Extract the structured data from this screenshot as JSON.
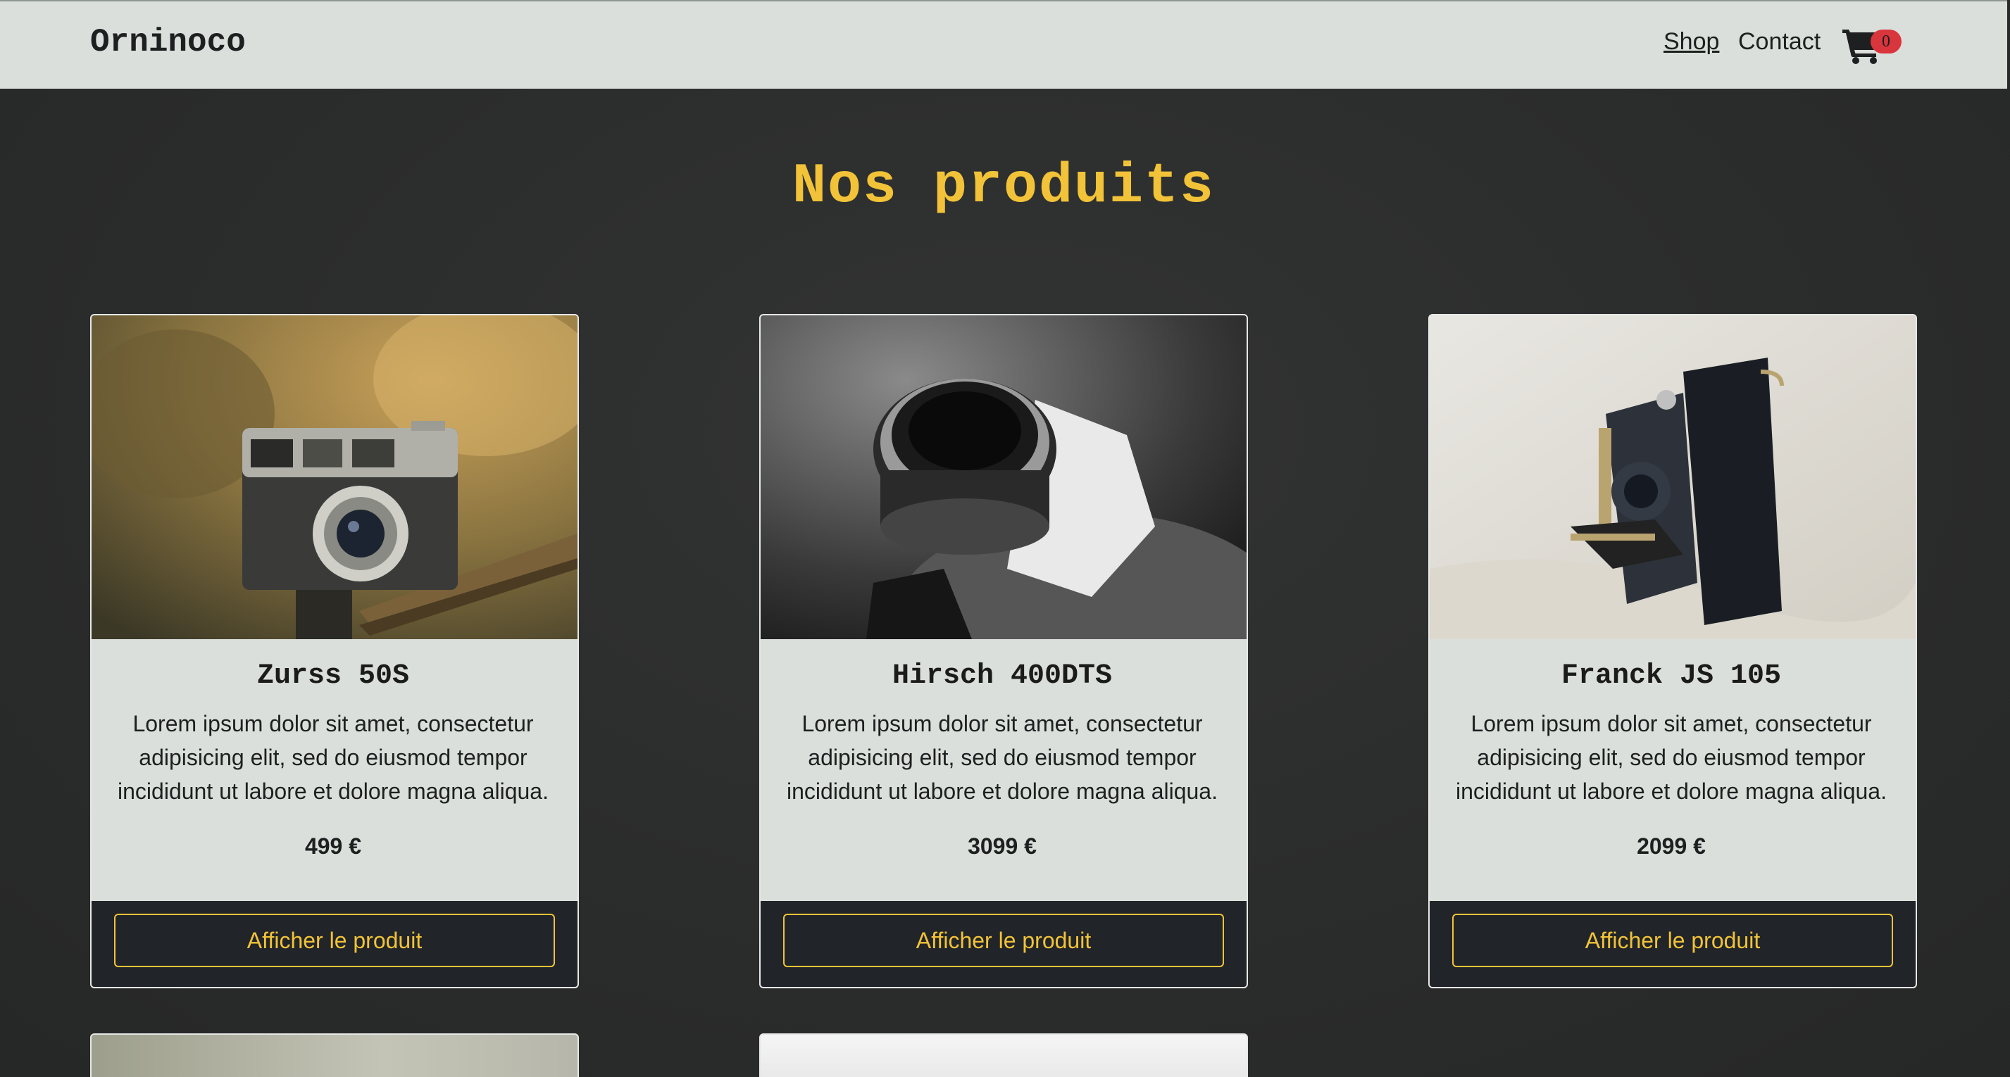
{
  "navbar": {
    "brand": "Orninoco",
    "links": [
      {
        "label": "Shop",
        "active": true
      },
      {
        "label": "Contact",
        "active": false
      }
    ],
    "cart": {
      "icon": "shopping-cart-icon",
      "count": "0",
      "badge_color": "#d9353d"
    }
  },
  "main": {
    "title": "Nos produits",
    "accent_color": "#f2c338",
    "products": [
      {
        "name": "Zurss 50S",
        "description": "Lorem ipsum dolor sit amet, consectetur adipisicing elit, sed do eiusmod tempor incididunt ut labore et dolore magna aliqua.",
        "price": "499 €",
        "button_label": "Afficher le produit",
        "image": "vintage rangefinder camera on fence post, golden field background"
      },
      {
        "name": "Hirsch 400DTS",
        "description": "Lorem ipsum dolor sit amet, consectetur adipisicing elit, sed do eiusmod tempor incididunt ut labore et dolore magna aliqua.",
        "price": "3099 €",
        "button_label": "Afficher le produit",
        "image": "black and white close-up of camera lens"
      },
      {
        "name": "Franck JS 105",
        "description": "Lorem ipsum dolor sit amet, consectetur adipisicing elit, sed do eiusmod tempor incididunt ut labore et dolore magna aliqua.",
        "price": "2099 €",
        "button_label": "Afficher le produit",
        "image": "antique black folding camera on white cloth"
      }
    ]
  },
  "colors": {
    "navbar_bg": "#dadfdb",
    "page_bg": "#2b2c2c",
    "card_footer_bg": "#212529"
  }
}
